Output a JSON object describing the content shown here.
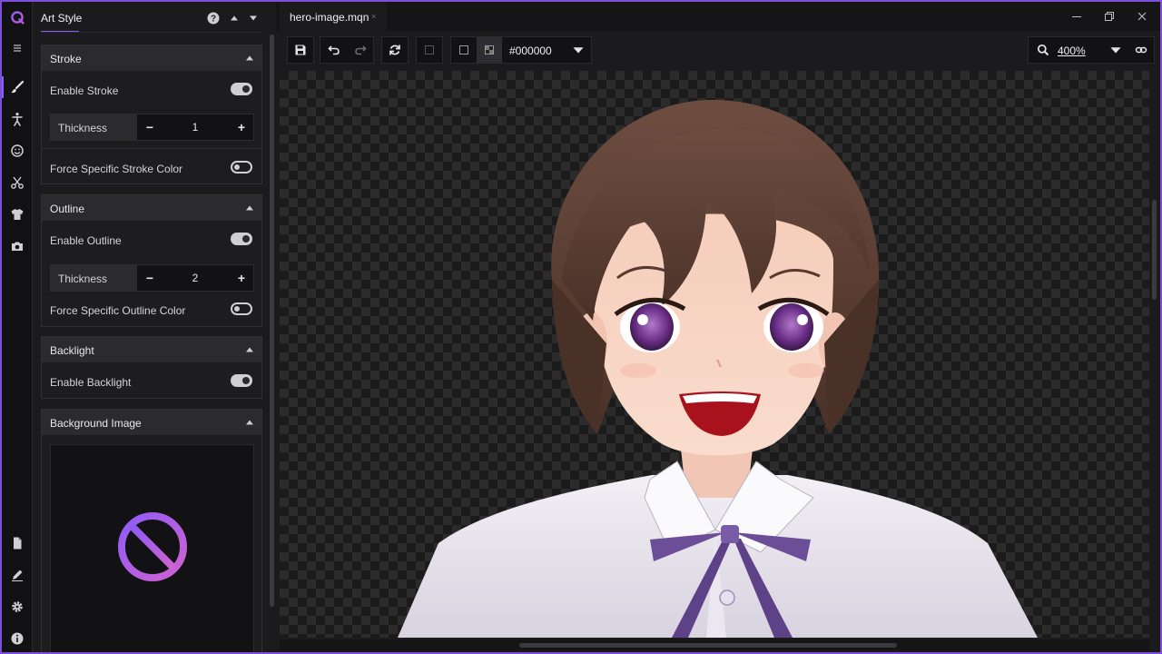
{
  "rail": {
    "items": [
      {
        "icon": "menu-icon"
      },
      {
        "icon": "brush-icon",
        "active": true
      },
      {
        "icon": "figure-icon"
      },
      {
        "icon": "face-icon"
      },
      {
        "icon": "scissors-icon"
      },
      {
        "icon": "shirt-icon"
      },
      {
        "icon": "camera-icon"
      },
      {
        "icon": "file-icon"
      },
      {
        "icon": "pen-icon"
      },
      {
        "icon": "gear-icon"
      },
      {
        "icon": "info-icon"
      }
    ]
  },
  "panel": {
    "title": "Art Style",
    "sections": {
      "stroke": {
        "title": "Stroke",
        "enable_label": "Enable Stroke",
        "enable_on": true,
        "thickness_label": "Thickness",
        "thickness_value": "1",
        "force_label": "Force Specific Stroke Color",
        "force_on": false
      },
      "outline": {
        "title": "Outline",
        "enable_label": "Enable Outline",
        "enable_on": true,
        "thickness_label": "Thickness",
        "thickness_value": "2",
        "force_label": "Force Specific Outline Color",
        "force_on": false
      },
      "backlight": {
        "title": "Backlight",
        "enable_label": "Enable Backlight",
        "enable_on": true
      },
      "background": {
        "title": "Background Image"
      }
    },
    "stepper_minus": "−",
    "stepper_plus": "+"
  },
  "tab": {
    "name": "hero-image.mqn",
    "close": "×"
  },
  "toolbar": {
    "color_hex": "#000000",
    "zoom": "400%"
  },
  "colors": {
    "accent": "#8d5cf6",
    "accent_pink": "#c65bd6",
    "panel_bg": "#1b1b1d",
    "section_head": "#2b2b2f"
  }
}
